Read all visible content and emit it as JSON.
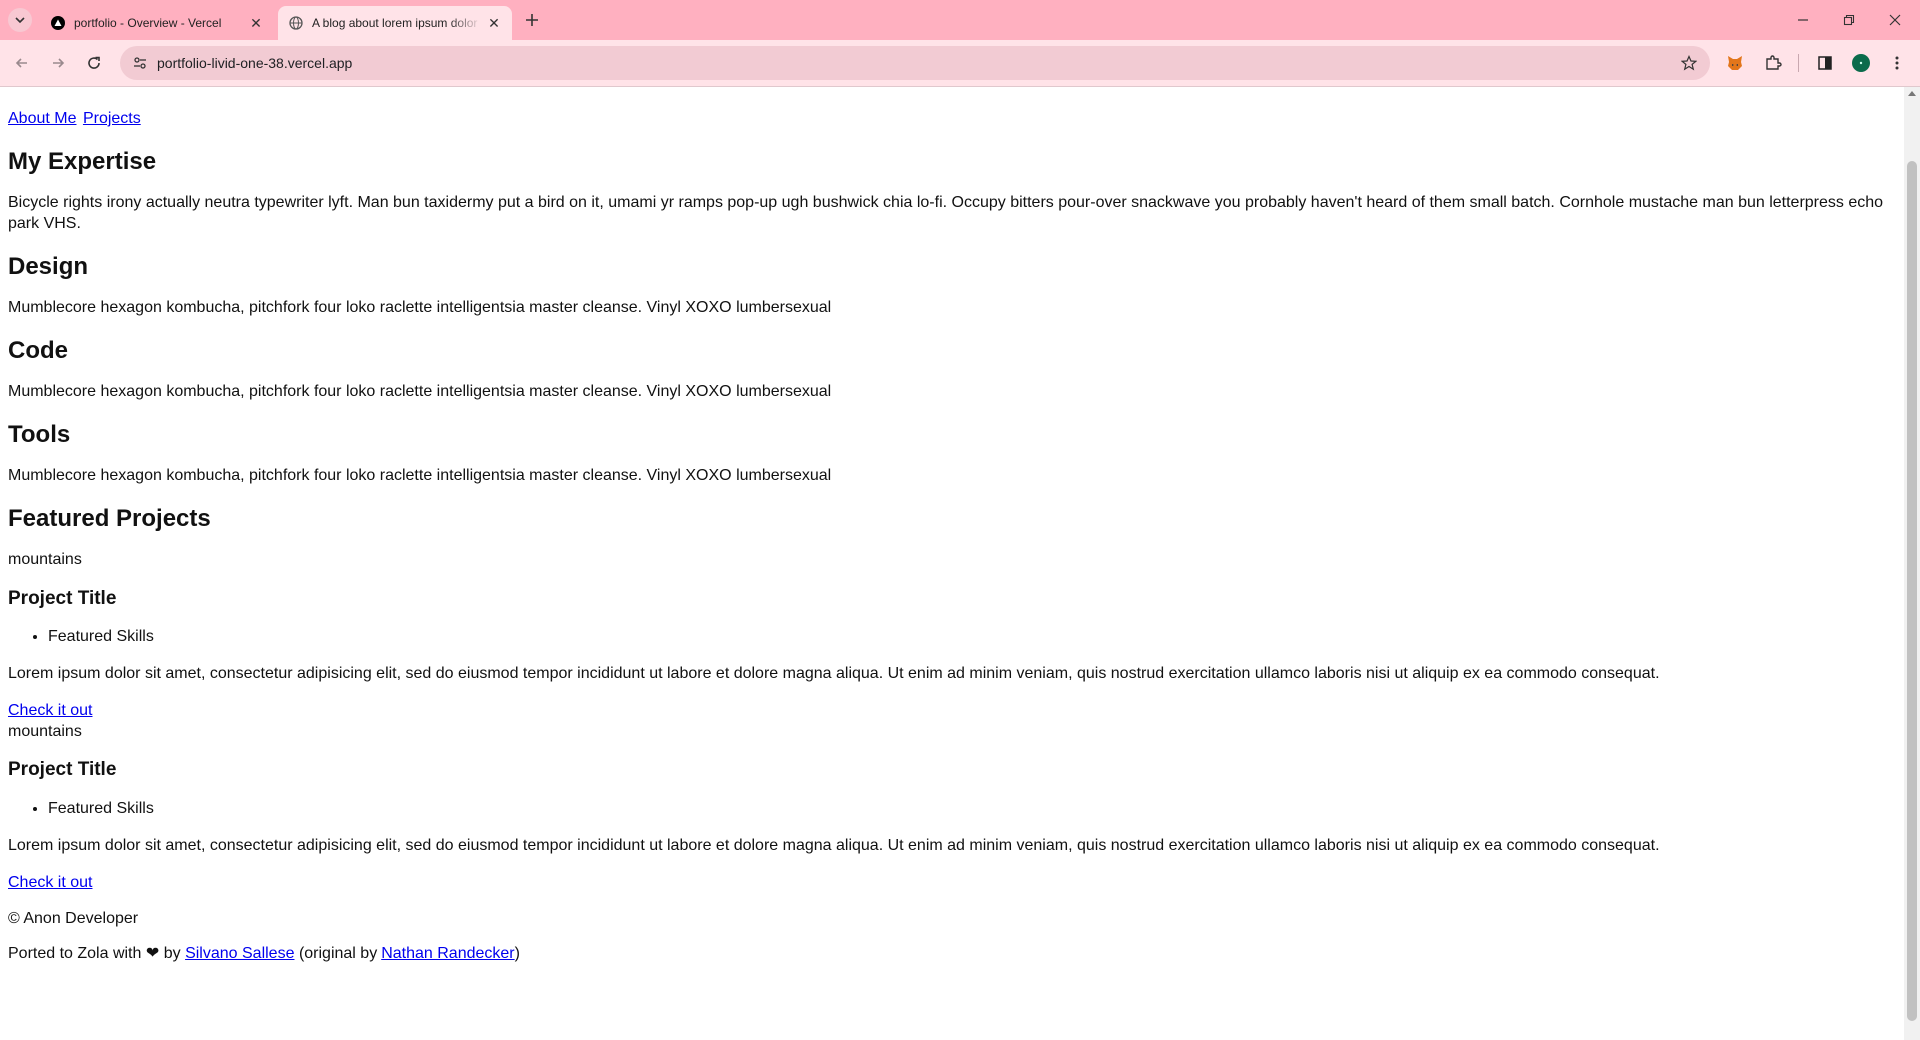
{
  "browser": {
    "tabs": [
      {
        "title": "portfolio - Overview - Vercel",
        "icon": "vercel-icon"
      },
      {
        "title": "A blog about lorem ipsum dolor",
        "icon": "globe-icon",
        "active": true
      }
    ],
    "url": "portfolio-livid-one-38.vercel.app",
    "colors": {
      "tabstrip": "#ffb0c0",
      "toolbar": "#ffe3e8",
      "omnibox": "#f2cbd3"
    }
  },
  "nav": {
    "about": "About Me",
    "projects": "Projects"
  },
  "expertise": {
    "heading": "My Expertise",
    "intro": "Bicycle rights irony actually neutra typewriter lyft. Man bun taxidermy put a bird on it, umami yr ramps pop-up ugh bushwick chia lo-fi. Occupy bitters pour-over snackwave you probably haven't heard of them small batch. Cornhole mustache man bun letterpress echo park VHS.",
    "sections": [
      {
        "title": "Design",
        "text": "Mumblecore hexagon kombucha, pitchfork four loko raclette intelligentsia master cleanse. Vinyl XOXO lumbersexual"
      },
      {
        "title": "Code",
        "text": "Mumblecore hexagon kombucha, pitchfork four loko raclette intelligentsia master cleanse. Vinyl XOXO lumbersexual"
      },
      {
        "title": "Tools",
        "text": "Mumblecore hexagon kombucha, pitchfork four loko raclette intelligentsia master cleanse. Vinyl XOXO lumbersexual"
      }
    ]
  },
  "projects": {
    "heading": "Featured Projects",
    "items": [
      {
        "image_alt": "mountains",
        "title": "Project Title",
        "skills": "Featured Skills",
        "text": "Lorem ipsum dolor sit amet, consectetur adipisicing elit, sed do eiusmod tempor incididunt ut labore et dolore magna aliqua. Ut enim ad minim veniam, quis nostrud exercitation ullamco laboris nisi ut aliquip ex ea commodo consequat.",
        "link": "Check it out"
      },
      {
        "image_alt": "mountains",
        "title": "Project Title",
        "skills": "Featured Skills",
        "text": "Lorem ipsum dolor sit amet, consectetur adipisicing elit, sed do eiusmod tempor incididunt ut labore et dolore magna aliqua. Ut enim ad minim veniam, quis nostrud exercitation ullamco laboris nisi ut aliquip ex ea commodo consequat.",
        "link": "Check it out"
      }
    ]
  },
  "footer": {
    "copyright": "© Anon Developer",
    "ported_prefix": "Ported to Zola with",
    "heart": "❤",
    "by": "by",
    "author": "Silvano Sallese",
    "original_prefix": "(original by",
    "original_author": "Nathan Randecker",
    "original_suffix": ")"
  }
}
